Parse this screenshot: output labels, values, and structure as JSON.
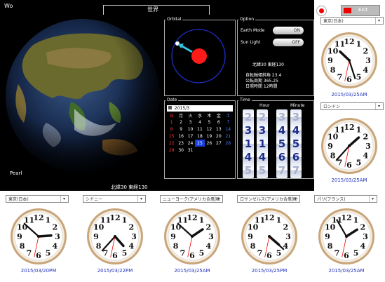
{
  "app": {
    "title_short": "Wo",
    "header_title": "世界"
  },
  "globe": {
    "location_name": "Pearl",
    "coords": "北緯30 東経130"
  },
  "orbital": {
    "label": "Orbital"
  },
  "option": {
    "label": "Option",
    "rows": [
      {
        "label": "Earth Mode",
        "toggle": "ON"
      },
      {
        "label": "Sun Light",
        "toggle": "OFF"
      }
    ],
    "coord_text": "北緯30 東経130",
    "info_lines": [
      "自転軸傾斜角 23.4",
      "公転周期 365.25",
      "日照時間 12時間"
    ]
  },
  "date": {
    "label": "Date",
    "month_header": "2015/3",
    "weekdays": [
      "日",
      "月",
      "火",
      "水",
      "木",
      "金",
      "土"
    ],
    "weeks": [
      [
        "1",
        "2",
        "3",
        "4",
        "5",
        "6",
        "7"
      ],
      [
        "8",
        "9",
        "10",
        "11",
        "12",
        "13",
        "14"
      ],
      [
        "15",
        "16",
        "17",
        "18",
        "19",
        "20",
        "21"
      ],
      [
        "22",
        "23",
        "24",
        "25",
        "26",
        "27",
        "28"
      ],
      [
        "29",
        "30",
        "31",
        "",
        "",
        "",
        ""
      ]
    ],
    "selected_day": "25"
  },
  "time": {
    "label": "Time",
    "hour_label": "Hour",
    "minute_label": "Minute",
    "hour_digits": [
      "2",
      "3",
      "1",
      "4",
      "5"
    ],
    "minute_digits": [
      "3",
      "4",
      "5",
      "6",
      "7"
    ],
    "hour_current": "14",
    "minute_current": "52"
  },
  "header_buttons": {
    "exit_label": "Exit"
  },
  "clocks": [
    {
      "select": "東京(日本)",
      "datetime": "2015/03/25AM",
      "hour": 10,
      "minute": 27,
      "second": 32
    },
    {
      "select": "ロンドン",
      "datetime": "2015/03/25AM",
      "hour": 1,
      "minute": 37,
      "second": 32
    },
    {
      "select": "東京(日本)",
      "datetime": "2015/03/20PM",
      "hour": 2,
      "minute": 52,
      "second": 32
    },
    {
      "select": "シドニー",
      "datetime": "2015/03/22PM",
      "hour": 4,
      "minute": 37,
      "second": 32
    },
    {
      "select": "ニューヨーク(アメリカ合衆国)",
      "datetime": "2015/03/25AM",
      "hour": 1,
      "minute": 52,
      "second": 32
    },
    {
      "select": "ロサンゼルス(アメリカ合衆国)",
      "datetime": "2015/03/25PM",
      "hour": 4,
      "minute": 22,
      "second": 32
    },
    {
      "select": "パリ(フランス)",
      "datetime": "2015/03/25AM",
      "hour": 1,
      "minute": 55,
      "second": 32
    }
  ]
}
